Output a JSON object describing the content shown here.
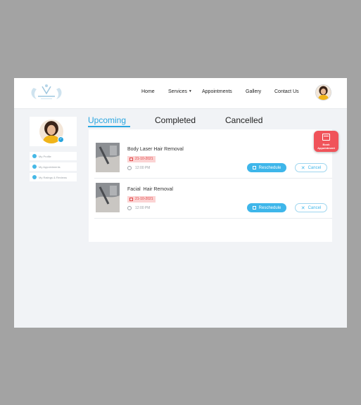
{
  "header": {
    "logo_alt": "Salon logo",
    "nav": [
      {
        "label": "Home"
      },
      {
        "label": "Services"
      },
      {
        "label": "Appointments"
      },
      {
        "label": "Gallery"
      },
      {
        "label": "Contact Us"
      }
    ]
  },
  "sidebar": {
    "items": [
      {
        "label": "My Profile"
      },
      {
        "label": "My Appointments"
      },
      {
        "label": "My Ratings & Reviews"
      }
    ]
  },
  "tabs": [
    {
      "label": "Upcoming",
      "active": true
    },
    {
      "label": "Completed",
      "active": false
    },
    {
      "label": "Cancelled",
      "active": false
    }
  ],
  "appointments": [
    {
      "service": "Body Laser Hair Removal",
      "date": "21-10-2021",
      "time": "12:00 PM"
    },
    {
      "service": "Facial  Hair Removal",
      "date": "21-10-2021",
      "time": "12:00 PM"
    }
  ],
  "actions": {
    "reschedule_label": "Reschedule",
    "cancel_label": "Cancel",
    "book_label_1": "Book",
    "book_label_2": "Appointment"
  },
  "icons": {
    "services_caret": "chevron-down-icon",
    "date": "calendar-icon",
    "time": "clock-icon",
    "cancel": "close-icon",
    "book": "calendar-icon"
  },
  "colors": {
    "accent": "#2aa6e0",
    "reschedule": "#3eb6ea",
    "book_button": "#f0535a",
    "date_badge_bg": "#fbd3d3",
    "date_badge_text": "#e04848"
  }
}
